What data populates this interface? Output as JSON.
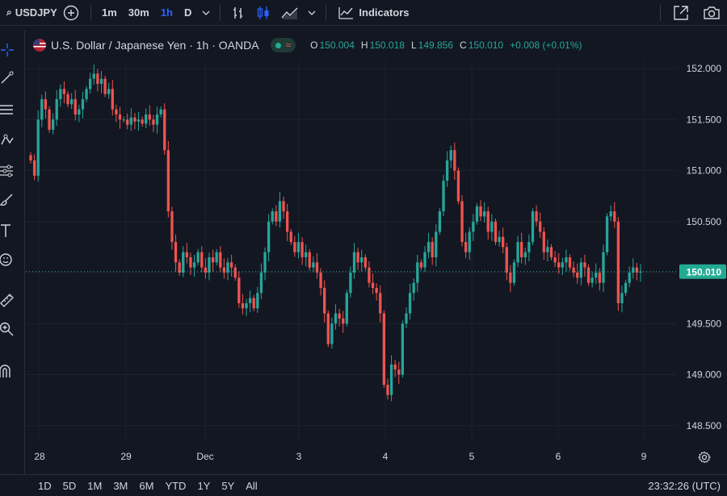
{
  "toolbar": {
    "symbol": "USDJPY",
    "timeframes": [
      "1m",
      "30m",
      "1h",
      "D"
    ],
    "active_timeframe": "1h",
    "indicators_label": "Indicators"
  },
  "legend": {
    "title": "U.S. Dollar / Japanese Yen · 1h · OANDA",
    "o_label": "O",
    "o_value": "150.004",
    "h_label": "H",
    "h_value": "150.018",
    "l_label": "L",
    "l_value": "149.856",
    "c_label": "C",
    "c_value": "150.010",
    "change": "+0.008 (+0.01%)"
  },
  "price_axis": {
    "ticks": [
      "152.000",
      "151.500",
      "151.000",
      "150.500",
      "150.000",
      "149.500",
      "149.000",
      "148.500"
    ],
    "current_price": "150.010"
  },
  "time_axis": {
    "labels": [
      "28",
      "29",
      "Dec",
      "3",
      "4",
      "5",
      "6",
      "9"
    ]
  },
  "bottom": {
    "ranges": [
      "1D",
      "5D",
      "1M",
      "3M",
      "6M",
      "YTD",
      "1Y",
      "5Y",
      "All"
    ],
    "clock": "23:32:26 (UTC)"
  },
  "colors": {
    "background": "#131722",
    "up": "#26a69a",
    "down": "#ef5350",
    "grid": "#1e222d",
    "price_label_bg": "#22ab94",
    "accent": "#2962ff"
  },
  "chart_data": {
    "type": "candlestick",
    "symbol": "USDJPY",
    "interval": "1h",
    "ylim": [
      148.35,
      152.25
    ],
    "y_ticks": [
      148.5,
      149.0,
      149.5,
      150.0,
      150.5,
      151.0,
      151.5,
      152.0
    ],
    "x_labels": [
      "28",
      "29",
      "Dec",
      "3",
      "4",
      "5",
      "6",
      "9"
    ],
    "current_price": 150.01,
    "closes": [
      151.1,
      150.95,
      151.5,
      151.7,
      151.6,
      151.4,
      151.5,
      151.7,
      151.8,
      151.75,
      151.65,
      151.7,
      151.55,
      151.6,
      151.7,
      151.8,
      151.9,
      151.95,
      151.85,
      151.9,
      151.75,
      151.8,
      151.6,
      151.55,
      151.5,
      151.5,
      151.45,
      151.52,
      151.48,
      151.5,
      151.46,
      151.55,
      151.5,
      151.45,
      151.55,
      151.6,
      151.2,
      150.6,
      150.3,
      150.1,
      150.0,
      150.2,
      150.15,
      150.05,
      150.1,
      150.2,
      150.05,
      150.0,
      150.15,
      150.1,
      150.2,
      150.05,
      150.0,
      150.1,
      150.05,
      149.95,
      149.7,
      149.65,
      149.7,
      149.75,
      149.65,
      149.8,
      150.0,
      150.2,
      150.5,
      150.6,
      150.5,
      150.7,
      150.6,
      150.4,
      150.3,
      150.2,
      150.3,
      150.15,
      150.2,
      150.05,
      150.1,
      150.0,
      149.85,
      149.6,
      149.3,
      149.5,
      149.6,
      149.55,
      149.5,
      149.8,
      150.0,
      150.2,
      150.1,
      150.15,
      150.05,
      149.9,
      149.85,
      149.8,
      149.6,
      148.9,
      148.8,
      149.1,
      149.05,
      149.0,
      149.5,
      149.6,
      149.8,
      149.9,
      150.1,
      150.05,
      150.2,
      150.3,
      150.15,
      150.4,
      150.6,
      150.9,
      151.1,
      151.2,
      151.0,
      150.7,
      150.3,
      150.2,
      150.4,
      150.5,
      150.65,
      150.55,
      150.6,
      150.4,
      150.5,
      150.3,
      150.35,
      150.25,
      150.0,
      149.9,
      150.1,
      150.3,
      150.15,
      150.2,
      150.3,
      150.6,
      150.5,
      150.4,
      150.2,
      150.25,
      150.15,
      150.1,
      150.05,
      150.1,
      150.15,
      150.05,
      150.0,
      149.95,
      150.1,
      150.05,
      149.9,
      149.95,
      150.0,
      149.9,
      150.2,
      150.55,
      150.6,
      150.5,
      149.7,
      149.8,
      149.9,
      150.0,
      150.05,
      150.0,
      150.01
    ]
  }
}
